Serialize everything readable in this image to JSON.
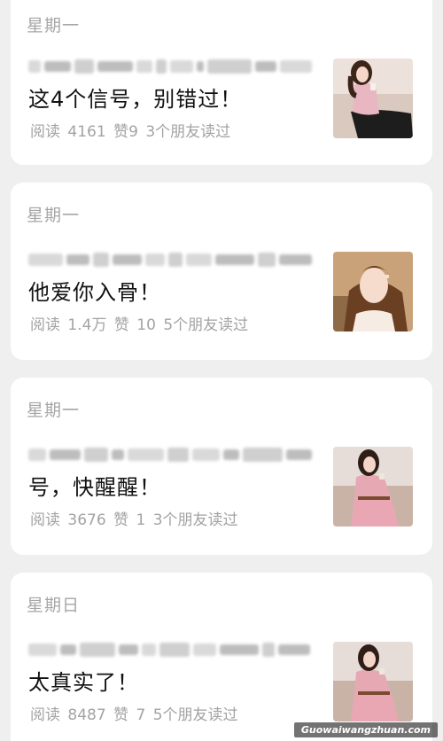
{
  "articles": [
    {
      "day": "星期一",
      "title": "这4个信号，别错过！",
      "reads_label": "阅读",
      "reads": "4161",
      "likes_label": "赞",
      "likes": "9",
      "friends": "3个朋友读过",
      "thumb_bg": "#ede1dc",
      "dress": "#e8b7c2",
      "skirt": "#1d1d1d",
      "hair": "#3b2418",
      "skin": "#f4d7c8"
    },
    {
      "day": "星期一",
      "title": "他爱你入骨！",
      "reads_label": "阅读",
      "reads": "1.4万",
      "likes_label": "赞",
      "likes": "10",
      "friends": "5个朋友读过",
      "thumb_bg": "#c9a27a",
      "dress": "#f6ece4",
      "skirt": "#f6ece4",
      "hair": "#6a3f22",
      "skin": "#f6dccd"
    },
    {
      "day": "星期一",
      "title": "号，快醒醒！",
      "reads_label": "阅读",
      "reads": "3676",
      "likes_label": "赞",
      "likes": "1",
      "friends": "3个朋友读过",
      "thumb_bg": "#e7ddd8",
      "dress": "#e6a9b4",
      "skirt": "#e9a7b3",
      "hair": "#2e1e17",
      "skin": "#f3d6c7"
    },
    {
      "day": "星期日",
      "title": "太真实了！",
      "reads_label": "阅读",
      "reads": "8487",
      "likes_label": "赞",
      "likes": "7",
      "friends": "5个朋友读过",
      "thumb_bg": "#e7ddd8",
      "dress": "#e6a9b4",
      "skirt": "#e9a7b3",
      "hair": "#2e1e17",
      "skin": "#f3d6c7"
    }
  ],
  "watermark": "Guowaiwangzhuan.com"
}
